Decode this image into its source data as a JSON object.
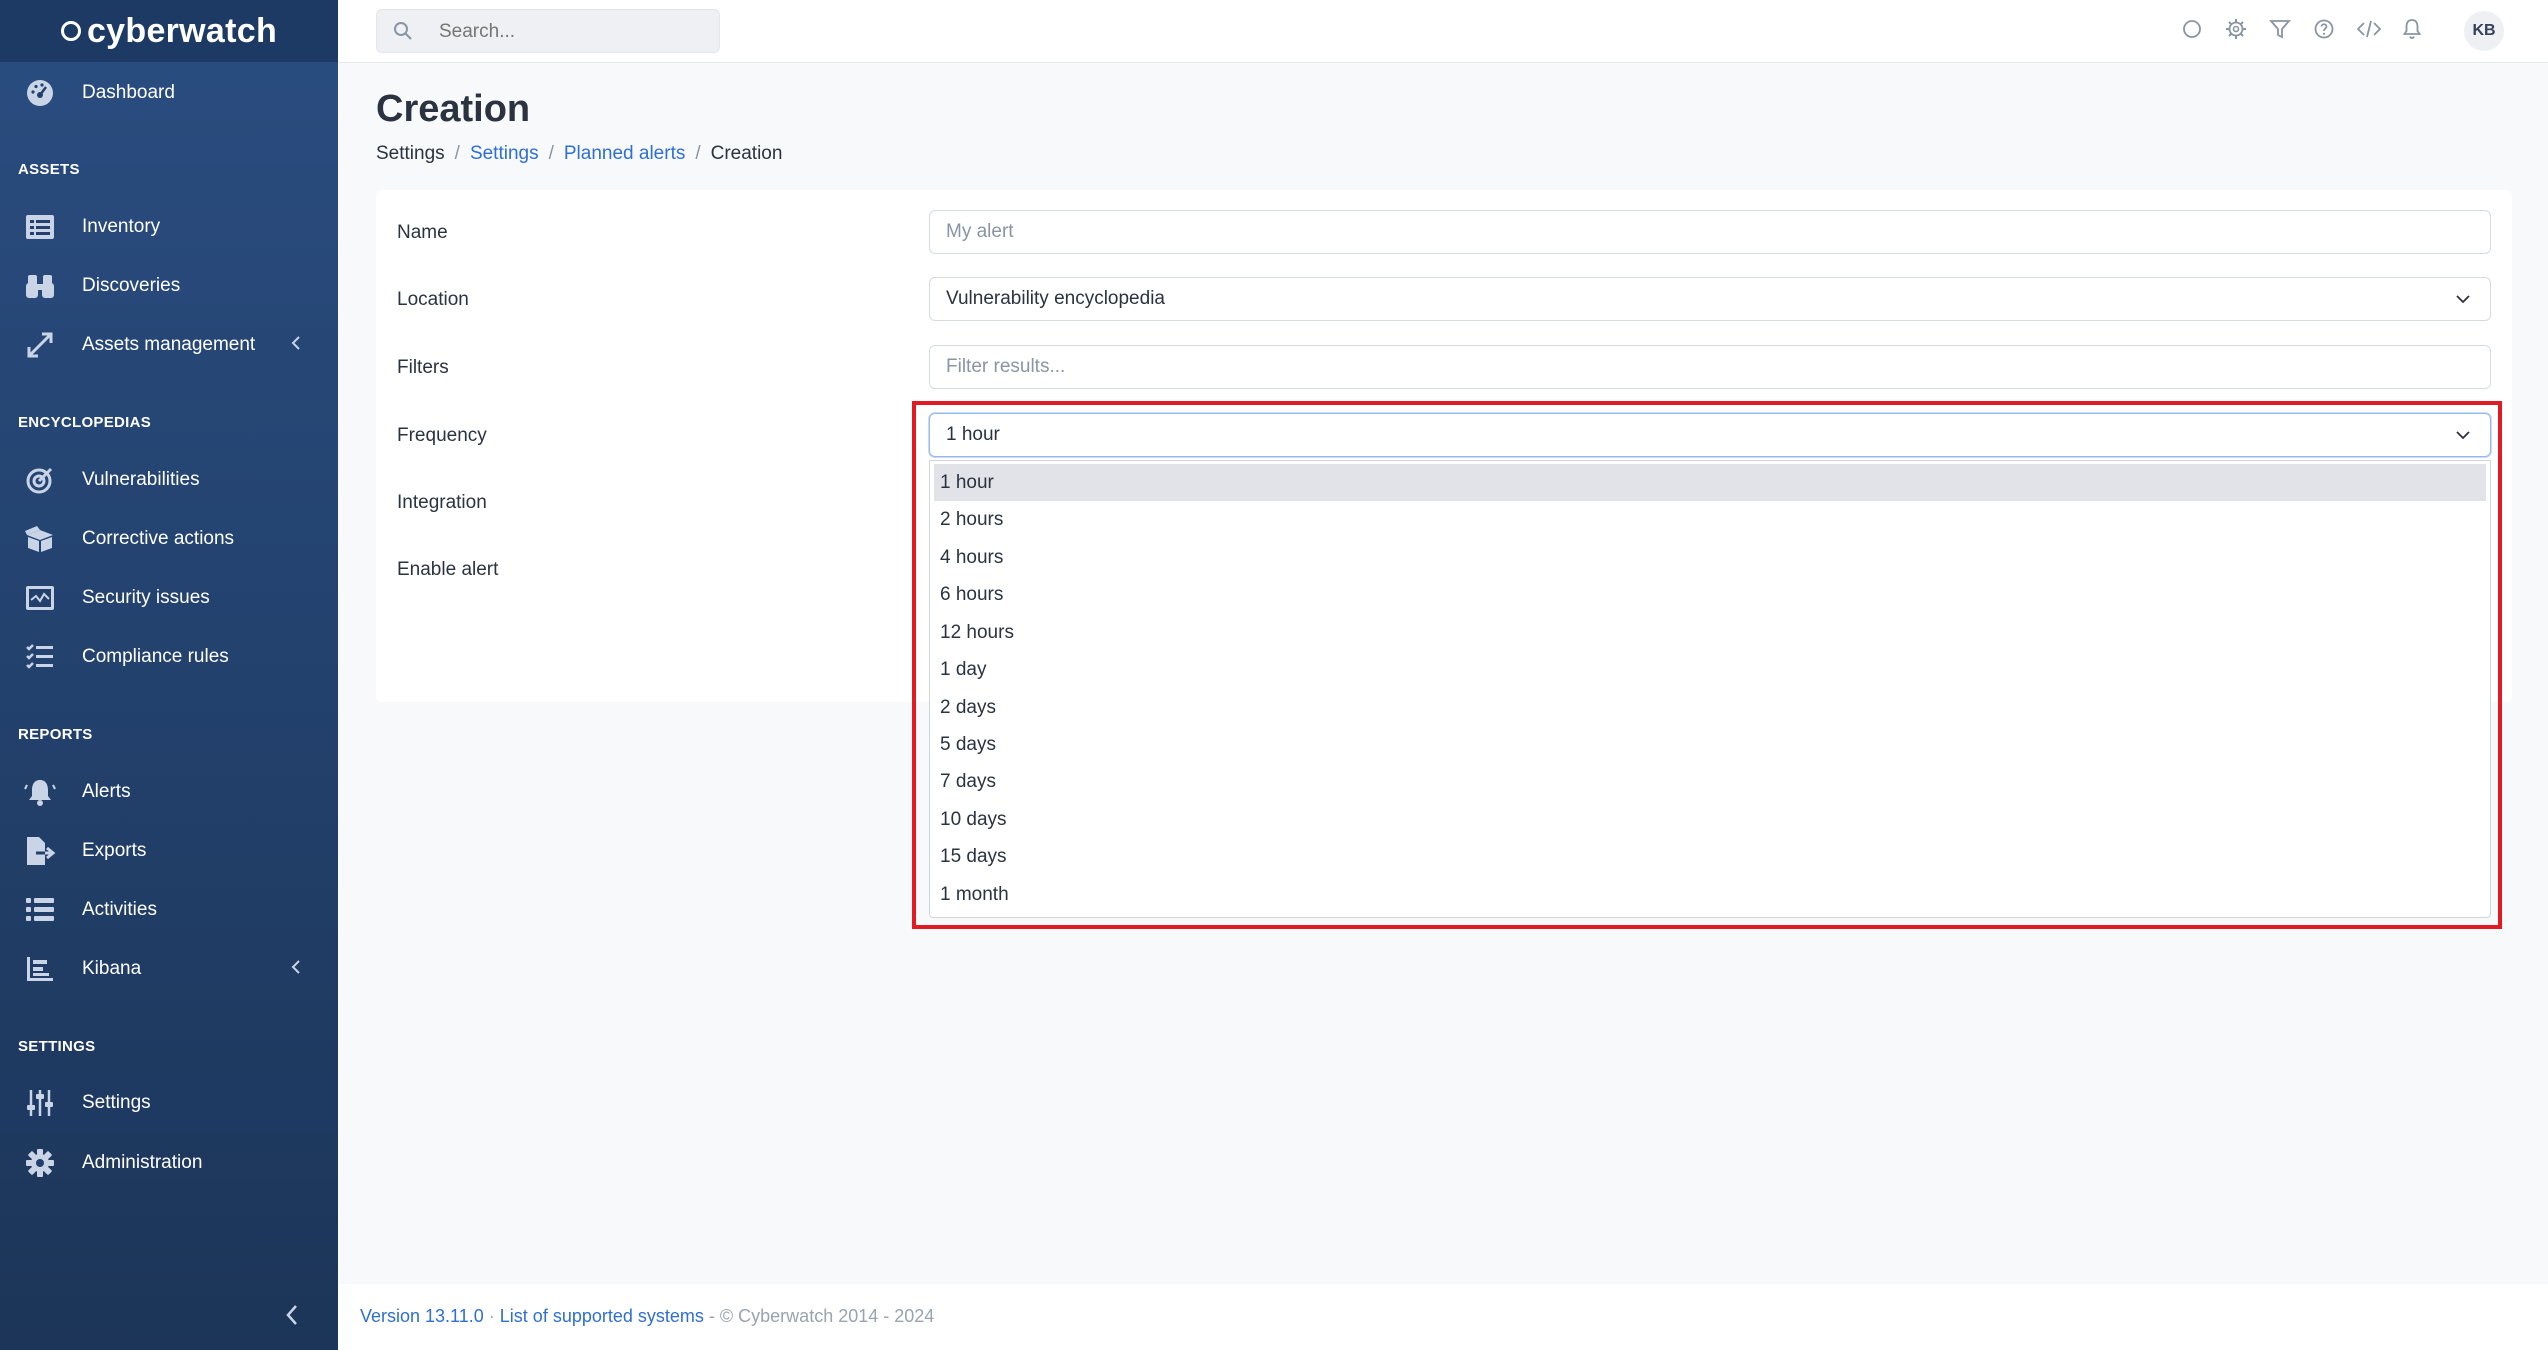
{
  "brand": {
    "name": "cyberwatch"
  },
  "search": {
    "placeholder": "Search..."
  },
  "topbar": {
    "icons": [
      "status-circle-icon",
      "gear-icon",
      "filter-icon",
      "help-icon",
      "code-icon",
      "bell-icon"
    ],
    "avatar_initials": "KB"
  },
  "sidebar": {
    "dashboard": "Dashboard",
    "sections": {
      "assets": "ASSETS",
      "encyclopedias": "ENCYCLOPEDIAS",
      "reports": "REPORTS",
      "settings": "SETTINGS"
    },
    "items": {
      "inventory": "Inventory",
      "discoveries": "Discoveries",
      "assets_management": "Assets management",
      "vulnerabilities": "Vulnerabilities",
      "corrective_actions": "Corrective actions",
      "security_issues": "Security issues",
      "compliance_rules": "Compliance rules",
      "alerts": "Alerts",
      "exports": "Exports",
      "activities": "Activities",
      "kibana": "Kibana",
      "settings": "Settings",
      "administration": "Administration"
    },
    "active_item": "Settings"
  },
  "page": {
    "title": "Creation",
    "breadcrumb": [
      "Settings",
      "Settings",
      "Planned alerts",
      "Creation"
    ]
  },
  "form": {
    "name_label": "Name",
    "name_placeholder": "My alert",
    "location_label": "Location",
    "location_value": "Vulnerability encyclopedia",
    "filters_label": "Filters",
    "filters_placeholder": "Filter results...",
    "frequency_label": "Frequency",
    "frequency_value": "1 hour",
    "integration_label": "Integration",
    "enable_label": "Enable alert"
  },
  "frequency_options": [
    "1 hour",
    "2 hours",
    "4 hours",
    "6 hours",
    "12 hours",
    "1 day",
    "2 days",
    "5 days",
    "7 days",
    "10 days",
    "15 days",
    "1 month"
  ],
  "footer": {
    "version": "Version 13.11.0",
    "dot": "·",
    "supported": "List of supported systems",
    "copyright": "- © Cyberwatch 2014 - 2024"
  },
  "colors": {
    "sidebar": "#22406b",
    "link": "#2f6fcf",
    "highlight": "#e01b24"
  }
}
